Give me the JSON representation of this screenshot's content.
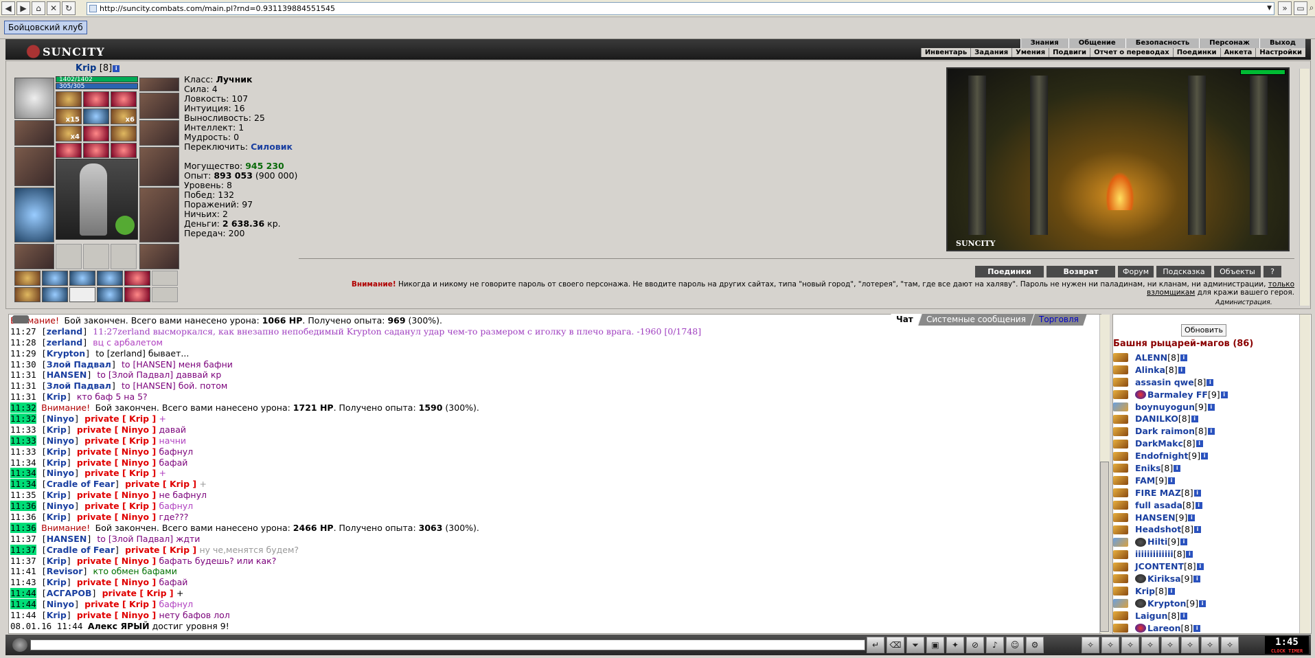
{
  "browser": {
    "url": "http://suncity.combats.com/main.pl?rnd=0.931139884551545",
    "tab_title": "Бойцовский клуб"
  },
  "header": {
    "logo": "SUNCITY",
    "top_menu": [
      "Знания",
      "Общение",
      "Безопасность",
      "Персонаж",
      "Выход"
    ],
    "sub_menu": [
      "Инвентарь",
      "Задания",
      "Умения",
      "Подвиги",
      "Отчет о переводах",
      "Поединки",
      "Анкета",
      "Настройки"
    ]
  },
  "character": {
    "name": "Krip",
    "level": "[8]",
    "hp": "1402/1402",
    "mp": "305/305",
    "slot_counts": [
      "x15",
      "x6",
      "x4"
    ],
    "stats": [
      {
        "label": "Класс: ",
        "value": "Лучник",
        "style": "b"
      },
      {
        "label": "Сила: ",
        "value": "4"
      },
      {
        "label": "Ловкость: ",
        "value": "107"
      },
      {
        "label": "Интуиция: ",
        "value": "16"
      },
      {
        "label": "Выносливость: ",
        "value": "25"
      },
      {
        "label": "Интеллект: ",
        "value": "1"
      },
      {
        "label": "Мудрость: ",
        "value": "0"
      },
      {
        "label": "Переключить: ",
        "value": "Силовик",
        "style": "blue"
      }
    ],
    "stats2": [
      {
        "label": "Могущество: ",
        "value": "945 230",
        "style": "green"
      },
      {
        "label": "Опыт: ",
        "value": "893 053",
        "extra": " (900 000)",
        "style": "b"
      },
      {
        "label": "Уровень: ",
        "value": "8"
      },
      {
        "label": "Побед: ",
        "value": "132"
      },
      {
        "label": "Поражений: ",
        "value": "97"
      },
      {
        "label": "Ничьих: ",
        "value": "2"
      },
      {
        "label": "Деньги: ",
        "value": "2 638.36",
        "extra": " кр.",
        "style": "b"
      },
      {
        "label": "Передач: ",
        "value": "200"
      }
    ]
  },
  "location": {
    "label": "SUNCITY"
  },
  "actions": [
    {
      "label": "Поединки",
      "bold": true,
      "w": 100
    },
    {
      "label": "Возврат",
      "bold": true,
      "w": 100
    },
    {
      "label": "Форум",
      "bold": false,
      "w": 52
    },
    {
      "label": "Подсказка",
      "bold": false,
      "w": 80
    },
    {
      "label": "Объекты",
      "bold": false,
      "w": 68
    },
    {
      "label": "?",
      "bold": false,
      "w": 26
    }
  ],
  "warning": {
    "prefix": "Внимание!",
    "text": " Никогда и никому не говорите пароль от своего персонажа. Не вводите пароль на других сайтах, типа \"новый город\", \"лотерея\", \"там, где все дают на халяву\". Пароль не нужен ни паладинам, ни кланам, ни администрации, ",
    "link": "только взломщикам",
    "suffix": " для кражи вашего героя.",
    "admin": "Администрация."
  },
  "chat_tabs": [
    "Чат",
    "Системные сообщения",
    "Торговля"
  ],
  "chat": [
    {
      "type": "sys",
      "time": "",
      "text": "Бой закончен. Всего вами нанесено урона: ",
      "b1": "1066 HP",
      "mid": ". Получено опыта: ",
      "b2": "969",
      "end": " (300%)."
    },
    {
      "type": "battle",
      "time": "11:27",
      "name": "zerland",
      "text": "11:27zerland высморкался, как внезапно непобедимый Krypton саданул удар чем-то размером с иголку в плечо врага. -1960 [0/1748]"
    },
    {
      "type": "say",
      "time": "11:28",
      "name": "zerland",
      "text": "вц с арбалетом",
      "cls": "purple"
    },
    {
      "type": "to",
      "time": "11:29",
      "name": "Krypton",
      "to": "to [zerland] бывает...",
      "cls": "black"
    },
    {
      "type": "to",
      "time": "11:30",
      "name": "Злой Падвал",
      "to": "to [HANSEN] меня бафни",
      "cls": ""
    },
    {
      "type": "to",
      "time": "11:31",
      "name": "HANSEN",
      "to": "to [Злой Падвал] даввай кр",
      "cls": ""
    },
    {
      "type": "to",
      "time": "11:31",
      "name": "Злой Падвал",
      "to": "to [HANSEN] бой. потом",
      "cls": ""
    },
    {
      "type": "say",
      "time": "11:31",
      "name": "Krip",
      "text": "кто баф 5 на 5?",
      "cls": ""
    },
    {
      "type": "sys",
      "time": "11:32",
      "hl": true,
      "text": "Бой закончен. Всего вами нанесено урона: ",
      "b1": "1721 HP",
      "mid": ". Получено опыта: ",
      "b2": "1590",
      "end": " (300%)."
    },
    {
      "type": "priv",
      "time": "11:32",
      "hl": true,
      "name": "Ninyo",
      "target": "Krip",
      "text": "+",
      "cls": "purple"
    },
    {
      "type": "priv",
      "time": "11:33",
      "name": "Krip",
      "target": "Ninyo",
      "text": "давай",
      "cls": ""
    },
    {
      "type": "priv",
      "time": "11:33",
      "hl": true,
      "name": "Ninyo",
      "target": "Krip",
      "text": "начни",
      "cls": "purple"
    },
    {
      "type": "priv",
      "time": "11:33",
      "name": "Krip",
      "target": "Ninyo",
      "text": "бафнул",
      "cls": ""
    },
    {
      "type": "priv",
      "time": "11:34",
      "name": "Krip",
      "target": "Ninyo",
      "text": "бафай",
      "cls": ""
    },
    {
      "type": "priv",
      "time": "11:34",
      "hl": true,
      "name": "Ninyo",
      "target": "Krip",
      "text": "+",
      "cls": "purple"
    },
    {
      "type": "priv",
      "time": "11:34",
      "hl": true,
      "name": "Cradle of Fear",
      "target": "Krip",
      "text": "+",
      "cls": "gray"
    },
    {
      "type": "priv",
      "time": "11:35",
      "name": "Krip",
      "target": "Ninyo",
      "text": "не бафнул",
      "cls": ""
    },
    {
      "type": "priv",
      "time": "11:36",
      "hl": true,
      "name": "Ninyo",
      "target": "Krip",
      "text": "бафнул",
      "cls": "purple"
    },
    {
      "type": "priv",
      "time": "11:36",
      "name": "Krip",
      "target": "Ninyo",
      "text": "где???",
      "cls": ""
    },
    {
      "type": "sys",
      "time": "11:36",
      "hl": true,
      "text": "Бой закончен. Всего вами нанесено урона: ",
      "b1": "2466 HP",
      "mid": ". Получено опыта: ",
      "b2": "3063",
      "end": " (300%)."
    },
    {
      "type": "to",
      "time": "11:37",
      "name": "HANSEN",
      "to": "to [Злой Падвал] ждти",
      "cls": ""
    },
    {
      "type": "priv",
      "time": "11:37",
      "hl": true,
      "name": "Cradle of Fear",
      "target": "Krip",
      "text": "ну че,менятся будем?",
      "cls": "gray"
    },
    {
      "type": "priv",
      "time": "11:37",
      "name": "Krip",
      "target": "Ninyo",
      "text": "бафать будешь? или как?",
      "cls": ""
    },
    {
      "type": "say",
      "time": "11:41",
      "name": "Revisor",
      "text": "кто обмен бафами",
      "cls": "green"
    },
    {
      "type": "priv",
      "time": "11:43",
      "name": "Krip",
      "target": "Ninyo",
      "text": "бафай",
      "cls": ""
    },
    {
      "type": "priv",
      "time": "11:44",
      "hl": true,
      "name": "АСГАРОВ",
      "target": "Krip",
      "text": "+",
      "cls": "black"
    },
    {
      "type": "priv",
      "time": "11:44",
      "hl": true,
      "name": "Ninyo",
      "target": "Krip",
      "text": "бафнул",
      "cls": "purple"
    },
    {
      "type": "priv",
      "time": "11:44",
      "name": "Krip",
      "target": "Ninyo",
      "text": "нету бафов лол",
      "cls": ""
    },
    {
      "type": "level",
      "time": "08.01.16 11:44",
      "name": "Алекс ЯРЫЙ",
      "text": " достиг уровня 9!"
    }
  ],
  "online": {
    "refresh": "Обновить",
    "room": "Башня рыцарей-магов (86)",
    "players": [
      {
        "name": "ALENN",
        "lvl": "[8]"
      },
      {
        "name": "Alinka",
        "lvl": "[8]"
      },
      {
        "name": "assasin qwe",
        "lvl": "[8]"
      },
      {
        "name": "Barmaley FF",
        "lvl": "[9]",
        "clan": "r"
      },
      {
        "name": "boynuyogun",
        "lvl": "[9]",
        "s": true
      },
      {
        "name": "DANILKO",
        "lvl": "[8]"
      },
      {
        "name": "Dark raimon",
        "lvl": "[8]"
      },
      {
        "name": "DarkMakc",
        "lvl": "[8]"
      },
      {
        "name": "Endofnight",
        "lvl": "[9]"
      },
      {
        "name": "Eniks",
        "lvl": "[8]"
      },
      {
        "name": "FAM",
        "lvl": "[9]"
      },
      {
        "name": "FIRE MAZ",
        "lvl": "[8]"
      },
      {
        "name": "full asada",
        "lvl": "[8]"
      },
      {
        "name": "HANSEN",
        "lvl": "[9]"
      },
      {
        "name": "Headshot",
        "lvl": "[8]"
      },
      {
        "name": "Hilti",
        "lvl": "[9]",
        "clan": "d",
        "s": true
      },
      {
        "name": "iiiiiiiiiiiii",
        "lvl": "[8]"
      },
      {
        "name": "JCONTENT",
        "lvl": "[8]"
      },
      {
        "name": "Kiriksa",
        "lvl": "[9]",
        "clan": "d"
      },
      {
        "name": "Krip",
        "lvl": "[8]"
      },
      {
        "name": "Krypton",
        "lvl": "[9]",
        "clan": "d",
        "s": true
      },
      {
        "name": "Laigun",
        "lvl": "[8]"
      },
      {
        "name": "Lareon",
        "lvl": "[8]",
        "clan": "r"
      }
    ]
  },
  "clock": {
    "time": "1:45",
    "label": "CLOCK TIMER"
  },
  "colors": {
    "hl": "#00dd77",
    "name": "#1a3fa0",
    "private": "#e00000",
    "warn": "#b00000"
  }
}
